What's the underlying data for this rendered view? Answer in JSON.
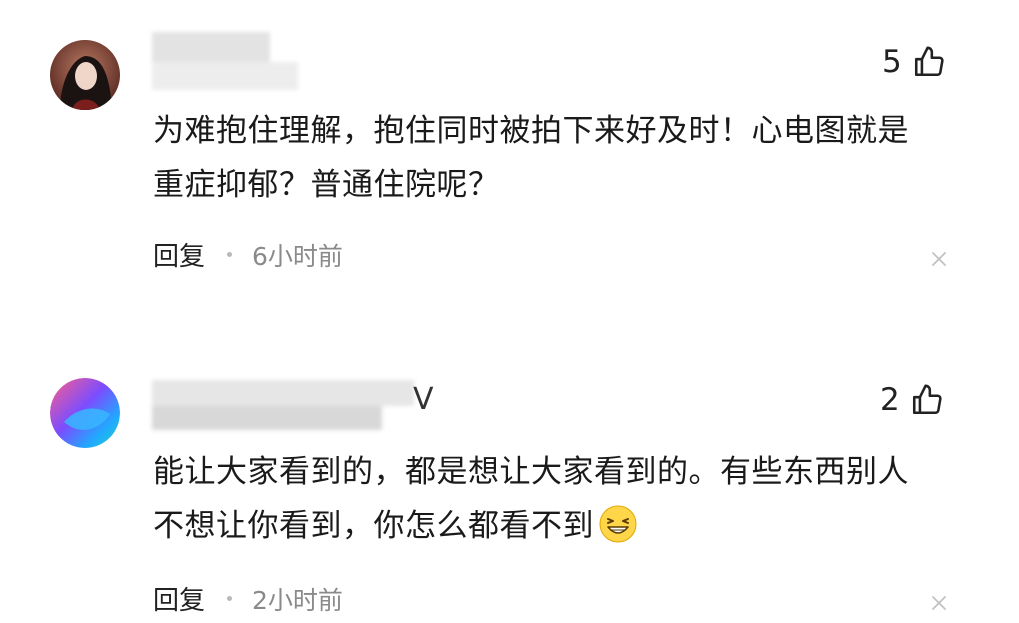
{
  "comments": [
    {
      "likes": "5",
      "text_line1": "为难抱住理解，抱住同时被拍下来好及时！心电图就是",
      "text_line2": "重症抑郁？普通住院呢？",
      "reply_label": "回复",
      "time": "6小时前"
    },
    {
      "likes": "2",
      "username_suffix": "V",
      "text_line1": "能让大家看到的，都是想让大家看到的。有些东西别人",
      "text_line2": "不想让你看到，你怎么都看不到",
      "emoji": "grinning-squint-emoji",
      "reply_label": "回复",
      "time": "2小时前"
    }
  ],
  "icons": {
    "like": "thumbs-up-icon",
    "close": "close-icon"
  },
  "colors": {
    "text": "#1a1a1a",
    "muted": "#8a8a8a",
    "close_icon": "#c2c2c2"
  }
}
